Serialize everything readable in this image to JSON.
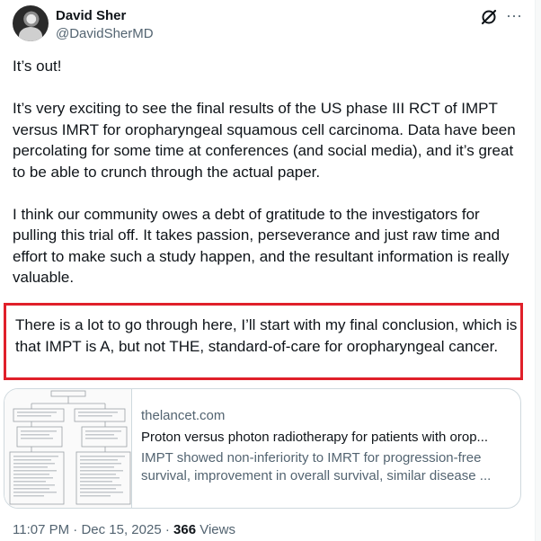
{
  "author": {
    "display_name": "David Sher",
    "handle": "@DavidSherMD"
  },
  "header_icons": {
    "grok": "grok-icon",
    "more": "more-icon",
    "more_glyph": "···"
  },
  "tweet": {
    "paragraphs": [
      "It’s out!",
      "It’s very exciting to see the final results of the US phase III RCT of IMPT versus IMRT for oropharyngeal squamous cell carcinoma. Data have been percolating for some time at conferences (and social media), and it’s great to be able to crunch through the actual paper.",
      "I think our community owes a debt of gratitude to the investigators for pulling this trial off. It takes passion, perseverance and just raw time and effort to make such a study happen, and the resultant information is really valuable."
    ],
    "highlighted": "There is a lot to go through here, I’ll start with my final conclusion, which is that IMPT is A, but not THE, standard-of-care for oropharyngeal cancer.",
    "highlight_color": "#e0202a"
  },
  "link_card": {
    "domain": "thelancet.com",
    "title": "Proton versus photon radiotherapy for patients with orop...",
    "description": "IMPT showed non-inferiority to IMRT for progression-free survival, improvement in overall survival, similar disease ..."
  },
  "meta": {
    "time": "11:07 PM",
    "separator1": " · ",
    "date": "Dec 15, 2025",
    "separator2": " · ",
    "views_count": "366",
    "views_label": " Views"
  }
}
